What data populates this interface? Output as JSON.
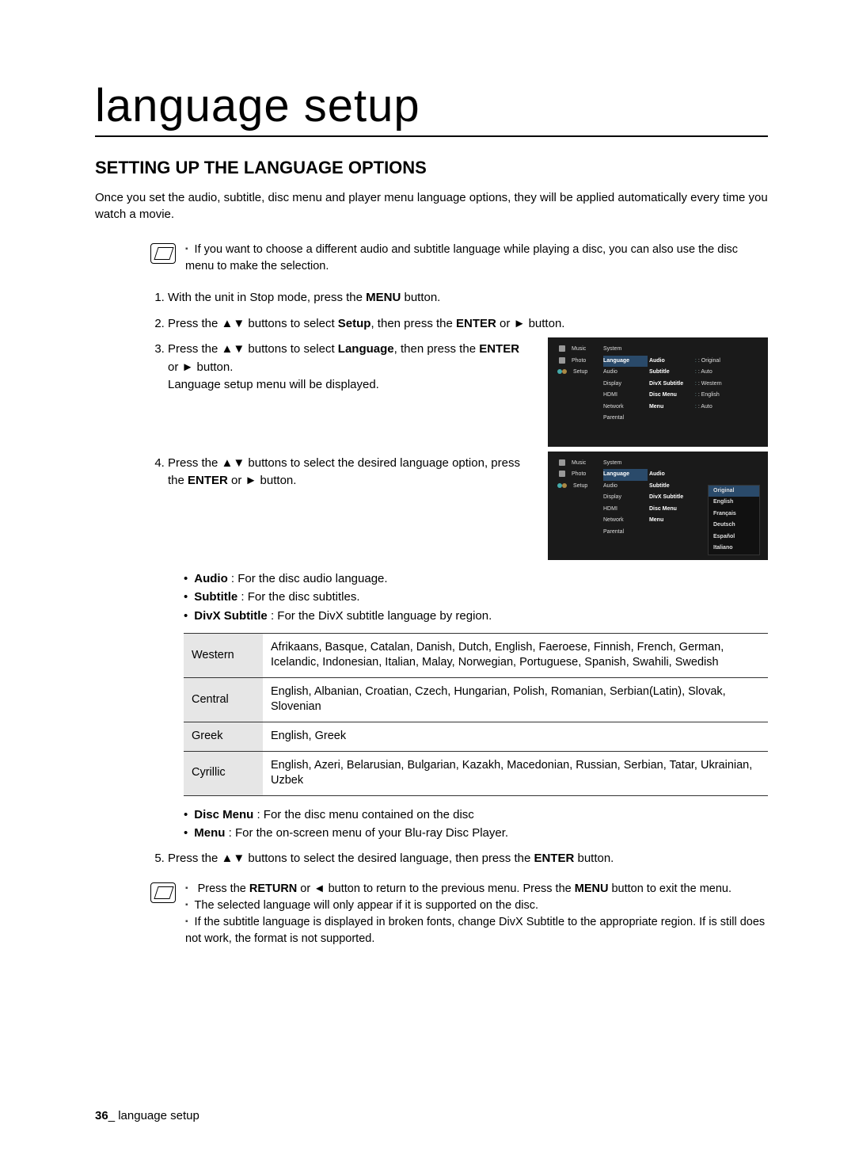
{
  "title": "language setup",
  "section_head": "SETTING UP THE LANGUAGE OPTIONS",
  "intro": "Once you set the audio, subtitle, disc menu and player menu language options, they will be applied automatically every time you watch a movie.",
  "note1": "If you want to choose a different audio and subtitle language while playing a disc, you can also use the disc menu to make the selection.",
  "steps": {
    "s1_a": "With the unit in Stop mode, press the ",
    "s1_b": "MENU",
    "s1_c": " button.",
    "s2_a": "Press the ▲▼ buttons to select ",
    "s2_b": "Setup",
    "s2_c": ", then press the ",
    "s2_d": "ENTER",
    "s2_e": " or ► button.",
    "s3_a": "Press the ▲▼ buttons to select ",
    "s3_b": "Language",
    "s3_c": ", then press the ",
    "s3_d": "ENTER",
    "s3_e": " or ► button.",
    "s3_f": "Language setup menu will be displayed.",
    "s4_a": "Press the ▲▼ buttons to select the desired language option, press the ",
    "s4_b": "ENTER",
    "s4_c": " or ► button.",
    "s5_a": "Press the ▲▼ buttons to select the desired language, then press the ",
    "s5_b": "ENTER",
    "s5_c": " button."
  },
  "tv": {
    "side": [
      "Music",
      "Photo",
      "Setup"
    ],
    "menu": [
      "System",
      "Language",
      "Audio",
      "Display",
      "HDMI",
      "Network",
      "Parental"
    ],
    "items": [
      "Audio",
      "Subtitle",
      "DivX Subtitle",
      "Disc Menu",
      "Menu"
    ],
    "vals1": [
      ": Original",
      ": Auto",
      ": Western",
      ": English",
      ": Auto"
    ],
    "dropdown": [
      "Original",
      "English",
      "Français",
      "Deutsch",
      "Español",
      "Italiano"
    ]
  },
  "bullets1": {
    "audio_b": "Audio",
    "audio_t": " : For the disc audio language.",
    "sub_b": "Subtitle",
    "sub_t": " : For the disc subtitles.",
    "divx_b": "DivX Subtitle",
    "divx_t": " : For the DivX subtitle language by region."
  },
  "table": {
    "r1h": "Western",
    "r1": "Afrikaans, Basque, Catalan, Danish, Dutch, English, Faeroese, Finnish, French, German, Icelandic, Indonesian, Italian, Malay, Norwegian, Portuguese, Spanish, Swahili, Swedish",
    "r2h": "Central",
    "r2": "English, Albanian, Croatian, Czech, Hungarian, Polish, Romanian, Serbian(Latin), Slovak, Slovenian",
    "r3h": "Greek",
    "r3": "English, Greek",
    "r4h": "Cyrillic",
    "r4": "English, Azeri, Belarusian, Bulgarian, Kazakh, Macedonian, Russian, Serbian, Tatar, Ukrainian, Uzbek"
  },
  "bullets2": {
    "dm_b": "Disc Menu",
    "dm_t": " : For the disc menu contained on the disc",
    "mn_b": "Menu",
    "mn_t": " : For the on-screen menu of your Blu-ray Disc Player."
  },
  "notes2": {
    "n1a": "Press the ",
    "n1b": "RETURN",
    "n1c": " or ◄ button to return to the previous menu. Press the ",
    "n1d": "MENU",
    "n1e": " button to exit the menu.",
    "n2": "The selected language will only appear if it is supported on the disc.",
    "n3": "If the subtitle language is displayed in broken fonts, change DivX Subtitle to the appropriate region. If is still does not work, the format is not supported."
  },
  "footer": {
    "page": "36",
    "sep": "_ ",
    "label": "language setup"
  }
}
